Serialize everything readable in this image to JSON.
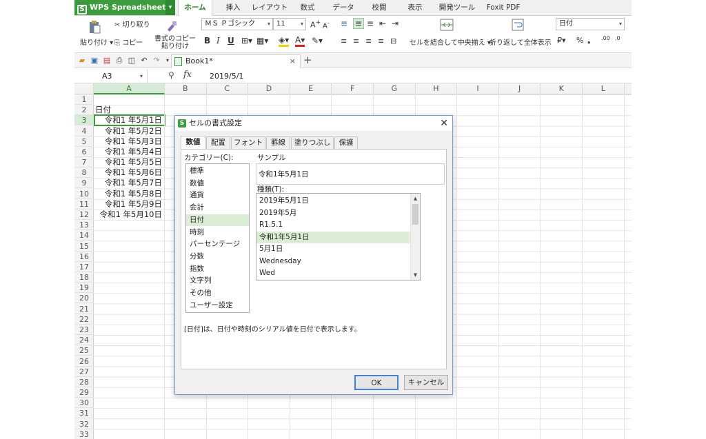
{
  "menubar": {
    "app_name": "WPS Spreadsheets",
    "tabs": [
      "ホーム",
      "挿入",
      "レイアウト",
      "数式",
      "データ",
      "校閲",
      "表示",
      "開発ツール",
      "Foxit PDF"
    ]
  },
  "ribbon": {
    "cut": "切り取り",
    "paste": "貼り付け",
    "copy": "コピー",
    "format_painter_1": "書式のコピー",
    "format_painter_2": "貼り付け",
    "font_name": "ＭＳ Ｐゴシック",
    "font_size": "11",
    "merge_center": "セルを結合して中央揃え",
    "wrap_text": "折り返して全体表示",
    "number_format": "日付",
    "percent": "%",
    "comma": "❟",
    "inc_decimal": ".00",
    "dec_decimal": ".0"
  },
  "workbook": {
    "tab_title": "Book1*"
  },
  "formula_bar": {
    "cell_ref": "A3",
    "fx": "fx",
    "value": "2019/5/1"
  },
  "grid": {
    "columns": [
      "A",
      "B",
      "C",
      "D",
      "E",
      "F",
      "G",
      "H",
      "I",
      "J",
      "K",
      "L"
    ],
    "rows": [
      "1",
      "2",
      "3",
      "4",
      "5",
      "6",
      "7",
      "8",
      "9",
      "10",
      "11",
      "12",
      "13",
      "14",
      "15",
      "16",
      "17",
      "18",
      "19",
      "20",
      "21",
      "22",
      "23",
      "24",
      "25",
      "26",
      "27",
      "28",
      "29",
      "30",
      "31",
      "32",
      "33"
    ],
    "header_cell": "日付",
    "dates": [
      "令和1 年5月1日",
      "令和1 年5月2日",
      "令和1 年5月3日",
      "令和1 年5月4日",
      "令和1 年5月5日",
      "令和1 年5月6日",
      "令和1 年5月7日",
      "令和1 年5月8日",
      "令和1 年5月9日",
      "令和1 年5月10日"
    ]
  },
  "dialog": {
    "title": "セルの書式設定",
    "tabs": [
      "数値",
      "配置",
      "フォント",
      "罫線",
      "塗りつぶし",
      "保護"
    ],
    "category_label": "カテゴリー(C):",
    "categories": [
      "標準",
      "数値",
      "通貨",
      "会計",
      "日付",
      "時刻",
      "パーセンテージ",
      "分数",
      "指数",
      "文字列",
      "その他",
      "ユーザー設定"
    ],
    "sample_label": "サンプル",
    "sample_value": "令和1年5月1日",
    "type_label": "種類(T):",
    "types": [
      "2019年5月1日",
      "2019年5月",
      "R1.5.1",
      "令和1年5月1日",
      "5月1日",
      "Wednesday",
      "Wed"
    ],
    "description": "[日付]は、日付や時刻のシリアル値を日付で表示します。",
    "ok": "OK",
    "cancel": "キャンセル"
  },
  "colors": {
    "accent": "#3c9b3c",
    "selection": "#dcedd6",
    "dialog_border": "#7a9cc6"
  }
}
